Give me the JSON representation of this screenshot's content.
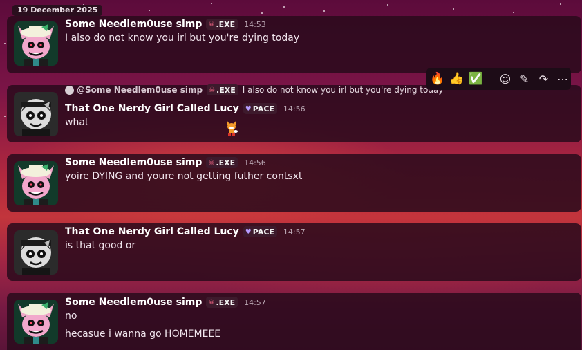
{
  "date_separator": "19 December 2025",
  "toolbar": {
    "reactions": [
      {
        "emoji": "🔥",
        "icon": "fire-icon"
      },
      {
        "emoji": "👍",
        "icon": "thumbs-up-icon"
      },
      {
        "emoji": "✅",
        "icon": "check-mark-icon"
      }
    ],
    "tools": [
      {
        "glyph": "☺",
        "icon": "add-reaction-icon"
      },
      {
        "glyph": "✎",
        "icon": "edit-icon"
      },
      {
        "glyph": "↷",
        "icon": "forward-icon"
      },
      {
        "glyph": "⋯",
        "icon": "more-icon"
      }
    ]
  },
  "messages": [
    {
      "author": "Some Needlem0use simp",
      "tag": ".EXE",
      "time": "14:53",
      "lines": [
        "I also do not know you irl but you're dying today"
      ]
    },
    {
      "reply": {
        "author": "@Some Needlem0use simp",
        "tag": ".EXE",
        "text": "I also do not know you irl but you're dying today"
      },
      "author": "That One Nerdy Girl Called Lucy",
      "tag": "PACE",
      "time": "14:56",
      "lines": [
        "what"
      ]
    },
    {
      "author": "Some Needlem0use simp",
      "tag": ".EXE",
      "time": "14:56",
      "lines": [
        "yoire DYING and youre not getting futher contsxt"
      ]
    },
    {
      "author": "That One Nerdy Girl Called Lucy",
      "tag": "PACE",
      "time": "14:57",
      "lines": [
        "is that good or"
      ]
    },
    {
      "author": "Some Needlem0use simp",
      "tag": ".EXE",
      "time": "14:57",
      "lines": [
        "no",
        "hecasue i wanna go HOMEMEEE"
      ]
    }
  ],
  "colors": {
    "card_bg": "#2a0a1c",
    "exe_badge_icon": "#ff6b8a",
    "pace_badge_icon": "#b79cff",
    "timestamp": "#b9a6b2"
  }
}
